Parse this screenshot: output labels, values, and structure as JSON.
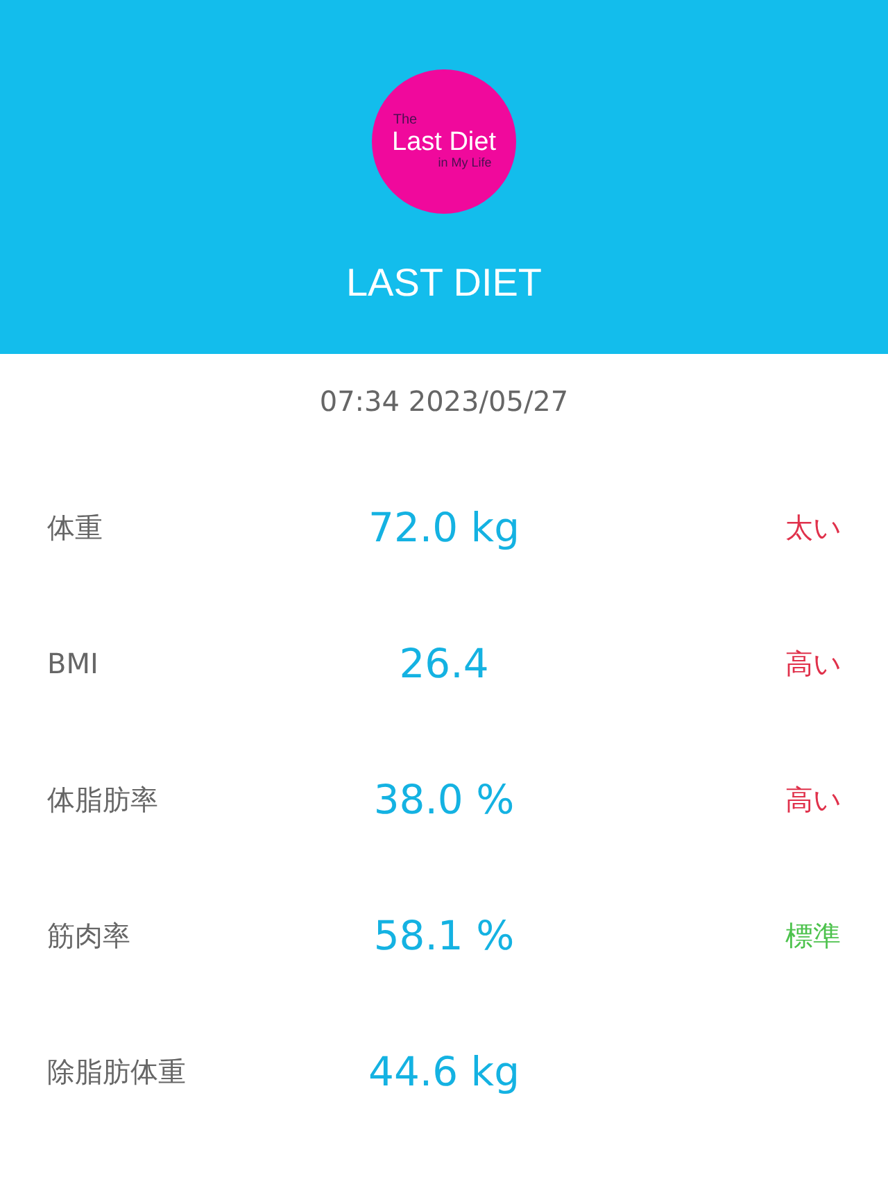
{
  "header": {
    "logo": {
      "line_1": "The",
      "line_2": "Last Diet",
      "line_3": "in My Life"
    },
    "title": "LAST DIET"
  },
  "timestamp": "07:34 2023/05/27",
  "metrics": [
    {
      "label": "体重",
      "value": "72.0 kg",
      "status": "太い",
      "color": "#e0314b"
    },
    {
      "label": "BMI",
      "value": "26.4",
      "status": "高い",
      "color": "#e0314b"
    },
    {
      "label": "体脂肪率",
      "value": "38.0 %",
      "status": "高い",
      "color": "#e0314b"
    },
    {
      "label": "筋肉率",
      "value": "58.1 %",
      "status": "標準",
      "color": "#4cc24c"
    },
    {
      "label": "除脂肪体重",
      "value": "44.6 kg"
    }
  ]
}
